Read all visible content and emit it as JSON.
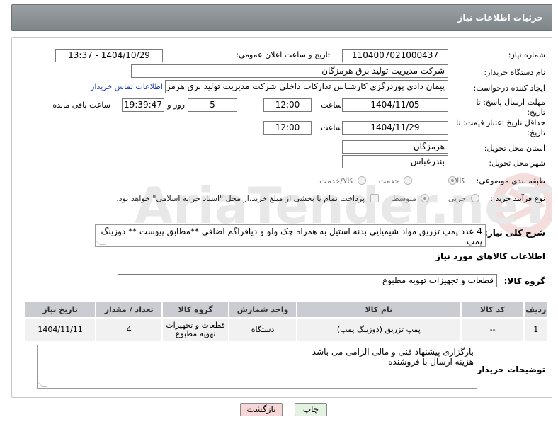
{
  "header": {
    "title": "جزئیات اطلاعات نیاز"
  },
  "fields": {
    "need_number_label": "شماره نیاز:",
    "need_number": "1104007021000437",
    "announce_label": "تاریخ و ساعت اعلان عمومی:",
    "announce_value": "1404/10/29 - 13:37",
    "buyer_org_label": "نام دستگاه خریدار:",
    "buyer_org": "شرکت مدیریت تولید برق هرمزگان",
    "creator_label": "ایجاد کننده درخواست:",
    "creator": "پیمان دادی پوردرگزی کارشناس تدارکات داخلی شرکت مدیریت تولید برق هرمزگان",
    "contact_link": "اطلاعات تماس خریدار",
    "deadline_label": "مهلت ارسال پاسخ: تا تاریخ:",
    "deadline_date": "1404/11/05",
    "time_label": "ساعت",
    "deadline_time": "12:00",
    "days_value": "5",
    "days_label": "روز و",
    "remaining_time": "19:39:47",
    "remaining_label": "ساعت باقی مانده",
    "min_validity_label": "حداقل تاریخ اعتبار قیمت: تا تاریخ:",
    "validity_date": "1404/11/29",
    "validity_time_label": "ساعت",
    "validity_time": "12:00",
    "province_label": "استان محل تحویل:",
    "province": "هرمزگان",
    "city_label": "شهر محل تحویل:",
    "city": "بندرعباس",
    "category_label": "طبقه بندی موضوعی:",
    "category_options": [
      "کالا",
      "خدمت",
      "کالا/خدمت"
    ],
    "category_selected": "کالا",
    "process_label": "نوع فرآیند خرید :",
    "process_options": [
      "جزیی",
      "متوسط"
    ],
    "process_selected": "متوسط",
    "payment_note": "پرداخت تمام یا بخشی از مبلغ خرید،از محل \"اسناد خزانه اسلامی\" خواهد بود."
  },
  "description": {
    "label": "شرح کلی نیاز:",
    "text": "4 عدد پمپ تزریق مواد شیمیایی بدنه استیل به همراه چک ولو و دیافراگم اضافی  **مطابق پیوست ** دوزینگ پمپ"
  },
  "goods": {
    "section_title": "اطلاعات کالاهای مورد نیاز",
    "group_label": "گروه کالا:",
    "group_value": "قطعات و تجهیزات تهویه مطبوع",
    "columns": [
      "ردیف",
      "کد کالا",
      "نام کالا",
      "واحد شمارش",
      "گروه کالا",
      "تعداد / مقدار",
      "تاریخ نیاز"
    ],
    "rows": [
      {
        "row": "1",
        "code": "--",
        "name": "پمپ تزریق (دوزینگ پمپ)",
        "unit": "دستگاه",
        "group": "قطعات و تجهیزات تهویه مطبوع",
        "qty": "4",
        "date": "1404/11/11"
      }
    ]
  },
  "buyer_notes": {
    "label": "توضیحات خریدار:",
    "line1": "بارگزاری پیشنهاد فنی و مالی الزامی می باشد",
    "line2": "هزینه ارسال با فروشنده"
  },
  "buttons": {
    "print": "چاپ",
    "back": "بازگشت"
  },
  "watermark": {
    "text": "AriaTender.neT"
  },
  "colors": {
    "header_bg": "#8a9094",
    "table_header": "#c9cdd1",
    "link": "#1a3ea8",
    "back_button": "#f6d6d6",
    "print_button": "#e4f3e1"
  }
}
